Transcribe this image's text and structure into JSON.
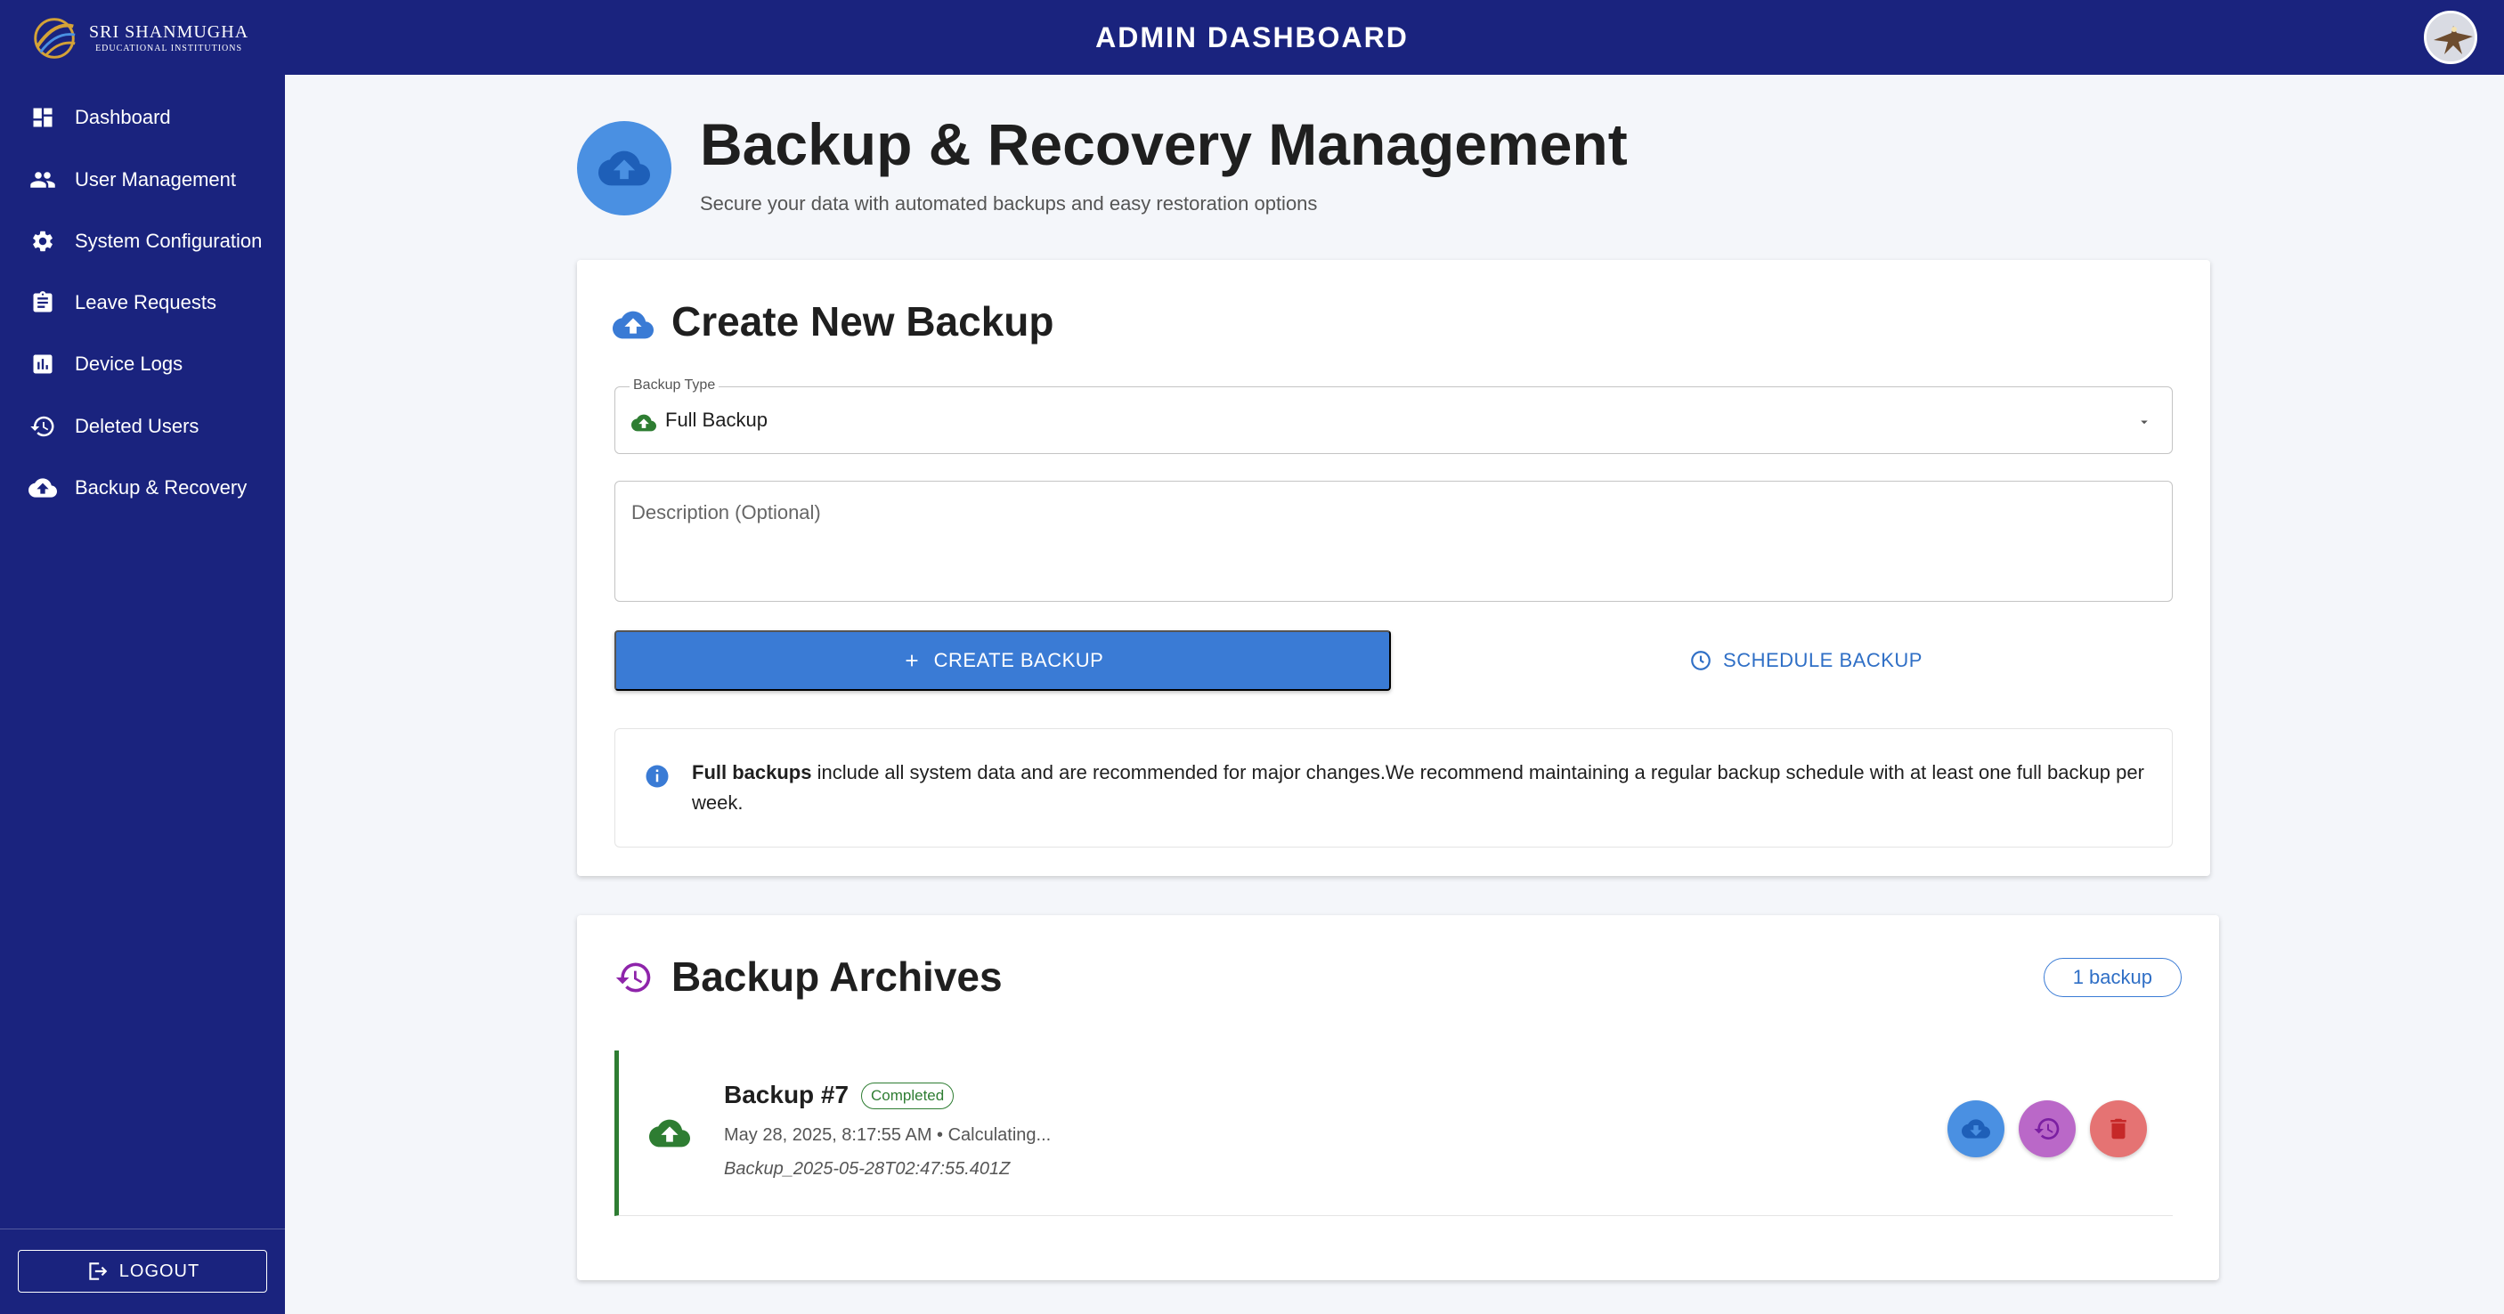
{
  "app": {
    "title": "ADMIN DASHBOARD",
    "logo_line1": "SRI SHANMUGHA",
    "logo_line2": "EDUCATIONAL INSTITUTIONS"
  },
  "sidebar": {
    "items": [
      {
        "label": "Dashboard",
        "icon": "dashboard-icon"
      },
      {
        "label": "User Management",
        "icon": "people-icon"
      },
      {
        "label": "System Configuration",
        "icon": "gear-icon"
      },
      {
        "label": "Leave Requests",
        "icon": "clipboard-icon"
      },
      {
        "label": "Device Logs",
        "icon": "chart-icon"
      },
      {
        "label": "Deleted Users",
        "icon": "restore-icon"
      },
      {
        "label": "Backup & Recovery",
        "icon": "cloud-upload-icon"
      }
    ],
    "logout_label": "LOGOUT"
  },
  "page": {
    "title": "Backup & Recovery Management",
    "subtitle": "Secure your data with automated backups and easy restoration options"
  },
  "create": {
    "title": "Create New Backup",
    "type_label": "Backup Type",
    "type_value": "Full Backup",
    "description_placeholder": "Description (Optional)",
    "create_label": "CREATE BACKUP",
    "schedule_label": "SCHEDULE BACKUP",
    "info_bold": "Full backups",
    "info_text": " include all system data and are recommended for major changes.We recommend maintaining a regular backup schedule with at least one full backup per week."
  },
  "archives": {
    "title": "Backup Archives",
    "count_label": "1 backup",
    "items": [
      {
        "name": "Backup #7",
        "status": "Completed",
        "meta": "May 28, 2025, 8:17:55 AM • Calculating...",
        "file": "Backup_2025-05-28T02:47:55.401Z"
      }
    ]
  },
  "colors": {
    "primary": "#1a237e",
    "accent": "#3a7bd5",
    "success": "#2e7d32",
    "restore": "#ab47bc",
    "danger": "#e53935"
  }
}
